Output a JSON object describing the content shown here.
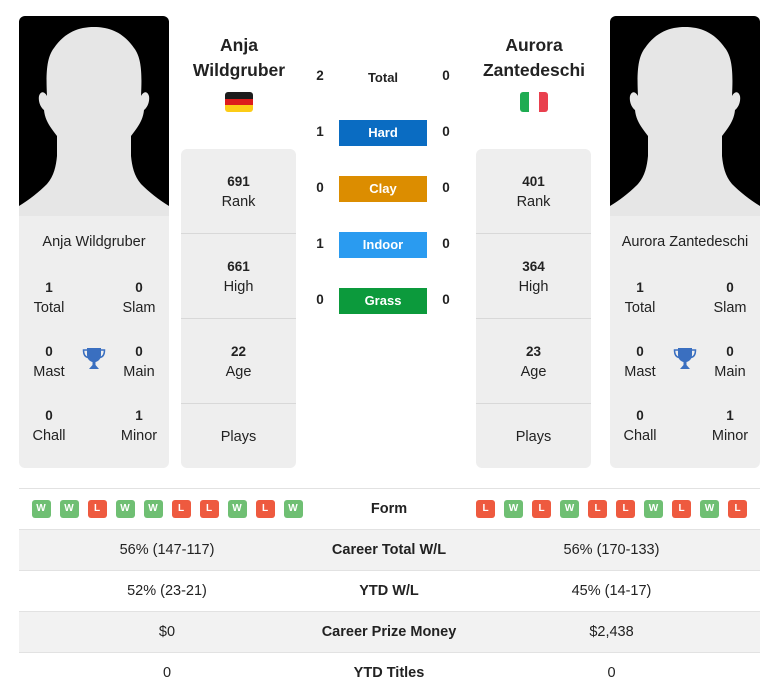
{
  "colors": {
    "hard": "#0a6cc2",
    "clay": "#dc8d00",
    "indoor": "#2a9bf0",
    "grass": "#0c9a3c",
    "win": "#6fbf73",
    "loss": "#ee5a3f",
    "trophy": "#3a6fc0"
  },
  "player1": {
    "name_line1": "Anja",
    "name_line2": "Wildgruber",
    "full_name": "Anja Wildgruber",
    "flag": "germany-flag",
    "titles": {
      "total": "1",
      "total_label": "Total",
      "slam": "0",
      "slam_label": "Slam",
      "mast": "0",
      "mast_label": "Mast",
      "main": "0",
      "main_label": "Main",
      "chall": "0",
      "chall_label": "Chall",
      "minor": "1",
      "minor_label": "Minor"
    },
    "rank": "691",
    "rank_label": "Rank",
    "high": "661",
    "high_label": "High",
    "age": "22",
    "age_label": "Age",
    "plays_label": "Plays",
    "form": [
      "W",
      "W",
      "L",
      "W",
      "W",
      "L",
      "L",
      "W",
      "L",
      "W"
    ],
    "career_wl": "56% (147-117)",
    "ytd_wl": "52% (23-21)",
    "prize": "$0",
    "ytd_titles": "0"
  },
  "player2": {
    "name_line1": "Aurora",
    "name_line2": "Zantedeschi",
    "full_name": "Aurora Zantedeschi",
    "flag": "italy-flag",
    "titles": {
      "total": "1",
      "total_label": "Total",
      "slam": "0",
      "slam_label": "Slam",
      "mast": "0",
      "mast_label": "Mast",
      "main": "0",
      "main_label": "Main",
      "chall": "0",
      "chall_label": "Chall",
      "minor": "1",
      "minor_label": "Minor"
    },
    "rank": "401",
    "rank_label": "Rank",
    "high": "364",
    "high_label": "High",
    "age": "23",
    "age_label": "Age",
    "plays_label": "Plays",
    "form": [
      "L",
      "W",
      "L",
      "W",
      "L",
      "L",
      "W",
      "L",
      "W",
      "L"
    ],
    "career_wl": "56% (170-133)",
    "ytd_wl": "45% (14-17)",
    "prize": "$2,438",
    "ytd_titles": "0"
  },
  "h2h": {
    "total": {
      "label": "Total",
      "p1": "2",
      "p2": "0"
    },
    "hard": {
      "label": "Hard",
      "p1": "1",
      "p2": "0"
    },
    "clay": {
      "label": "Clay",
      "p1": "0",
      "p2": "0"
    },
    "indoor": {
      "label": "Indoor",
      "p1": "1",
      "p2": "0"
    },
    "grass": {
      "label": "Grass",
      "p1": "0",
      "p2": "0"
    }
  },
  "table": {
    "form_label": "Form",
    "career_wl_label": "Career Total W/L",
    "ytd_wl_label": "YTD W/L",
    "prize_label": "Career Prize Money",
    "ytd_titles_label": "YTD Titles"
  }
}
